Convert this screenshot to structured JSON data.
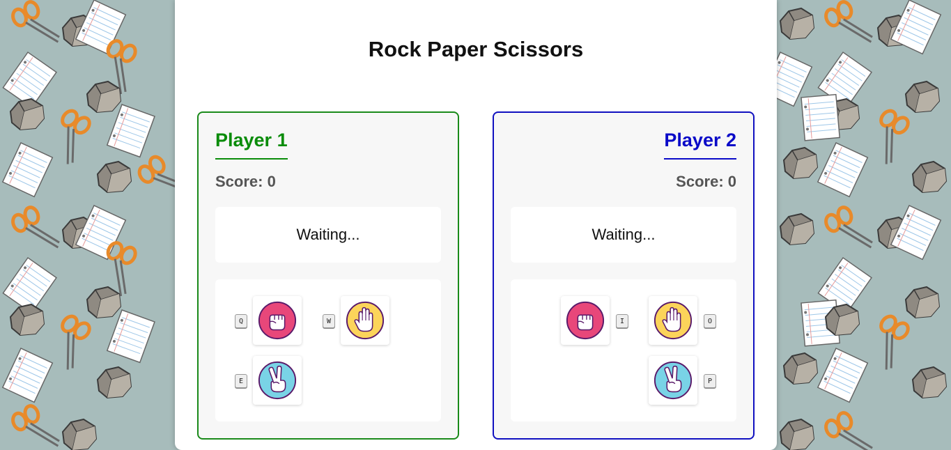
{
  "app": {
    "title": "Rock Paper Scissors"
  },
  "players": [
    {
      "name": "Player 1",
      "score_text": "Score: 0",
      "status": "Waiting...",
      "color": "#0a8c0a",
      "moves": [
        {
          "move": "rock",
          "key": "Q"
        },
        {
          "move": "paper",
          "key": "W"
        },
        {
          "move": "scissors",
          "key": "E"
        }
      ]
    },
    {
      "name": "Player 2",
      "score_text": "Score: 0",
      "status": "Waiting...",
      "color": "#0a0ac8",
      "moves": [
        {
          "move": "rock",
          "key": "I"
        },
        {
          "move": "paper",
          "key": "O"
        },
        {
          "move": "scissors",
          "key": "P"
        }
      ]
    }
  ],
  "icons": {
    "rock": "fist-icon",
    "paper": "open-hand-icon",
    "scissors": "victory-hand-icon"
  },
  "colors": {
    "rock": "#e8477a",
    "paper": "#fcd45a",
    "scissors": "#79d3e6",
    "background": "#a7bcbb"
  }
}
